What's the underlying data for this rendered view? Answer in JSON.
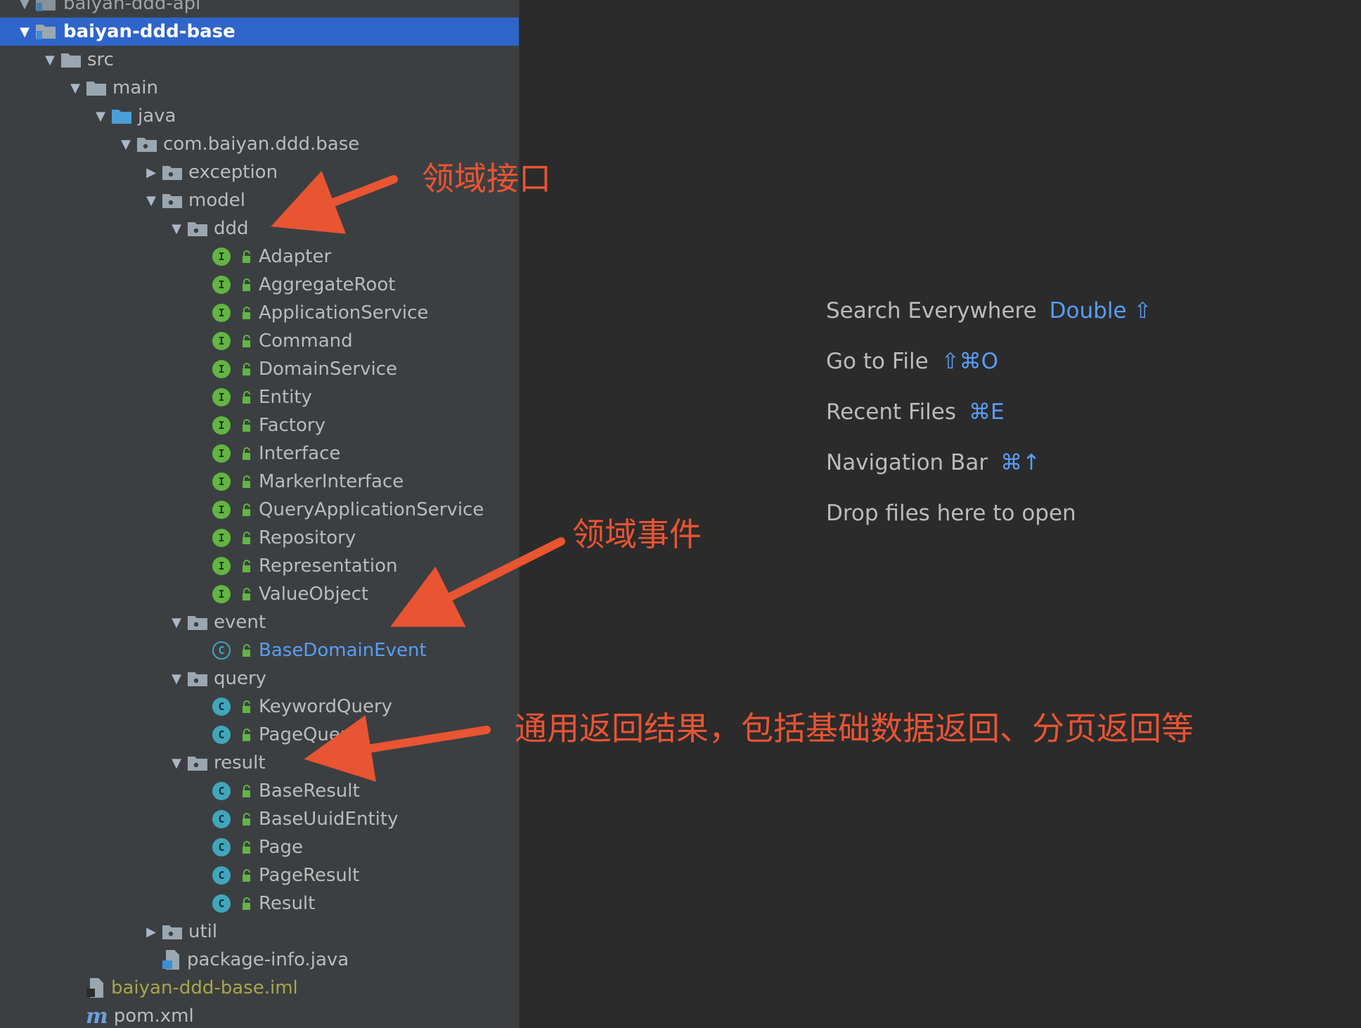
{
  "tree": {
    "rows": [
      {
        "label": "baiyan-ddd-api",
        "arrow": "expanded",
        "icon": "module-folder-icon",
        "partial": true
      },
      {
        "label": "baiyan-ddd-base",
        "arrow": "expanded",
        "icon": "module-folder-icon",
        "selected": true
      },
      {
        "label": "src",
        "arrow": "expanded",
        "icon": "folder-icon"
      },
      {
        "label": "main",
        "arrow": "expanded",
        "icon": "folder-icon"
      },
      {
        "label": "java",
        "arrow": "expanded",
        "icon": "source-folder-icon"
      },
      {
        "label": "com.baiyan.ddd.base",
        "arrow": "expanded",
        "icon": "package-icon"
      },
      {
        "label": "exception",
        "arrow": "collapsed",
        "icon": "package-icon"
      },
      {
        "label": "model",
        "arrow": "expanded",
        "icon": "package-icon"
      },
      {
        "label": "ddd",
        "arrow": "expanded",
        "icon": "package-icon"
      },
      {
        "label": "Adapter",
        "arrow": "none",
        "icon": "interface-icon"
      },
      {
        "label": "AggregateRoot",
        "arrow": "none",
        "icon": "interface-icon"
      },
      {
        "label": "ApplicationService",
        "arrow": "none",
        "icon": "interface-icon"
      },
      {
        "label": "Command",
        "arrow": "none",
        "icon": "interface-icon"
      },
      {
        "label": "DomainService",
        "arrow": "none",
        "icon": "interface-icon"
      },
      {
        "label": "Entity",
        "arrow": "none",
        "icon": "interface-icon"
      },
      {
        "label": "Factory",
        "arrow": "none",
        "icon": "interface-icon"
      },
      {
        "label": "Interface",
        "arrow": "none",
        "icon": "interface-icon"
      },
      {
        "label": "MarkerInterface",
        "arrow": "none",
        "icon": "interface-icon"
      },
      {
        "label": "QueryApplicationService",
        "arrow": "none",
        "icon": "interface-icon"
      },
      {
        "label": "Repository",
        "arrow": "none",
        "icon": "interface-icon"
      },
      {
        "label": "Representation",
        "arrow": "none",
        "icon": "interface-icon"
      },
      {
        "label": "ValueObject",
        "arrow": "none",
        "icon": "interface-icon"
      },
      {
        "label": "event",
        "arrow": "expanded",
        "icon": "package-icon"
      },
      {
        "label": "BaseDomainEvent",
        "arrow": "none",
        "icon": "abstract-class-icon",
        "color": "blue"
      },
      {
        "label": "query",
        "arrow": "expanded",
        "icon": "package-icon"
      },
      {
        "label": "KeywordQuery",
        "arrow": "none",
        "icon": "class-icon"
      },
      {
        "label": "PageQuery",
        "arrow": "none",
        "icon": "class-icon"
      },
      {
        "label": "result",
        "arrow": "expanded",
        "icon": "package-icon"
      },
      {
        "label": "BaseResult",
        "arrow": "none",
        "icon": "class-icon"
      },
      {
        "label": "BaseUuidEntity",
        "arrow": "none",
        "icon": "class-icon"
      },
      {
        "label": "Page",
        "arrow": "none",
        "icon": "class-icon"
      },
      {
        "label": "PageResult",
        "arrow": "none",
        "icon": "class-icon"
      },
      {
        "label": "Result",
        "arrow": "none",
        "icon": "class-icon"
      },
      {
        "label": "util",
        "arrow": "collapsed",
        "icon": "package-icon"
      },
      {
        "label": "package-info.java",
        "arrow": "none",
        "icon": "java-file-icon"
      },
      {
        "label": "baiyan-ddd-base.iml",
        "arrow": "none",
        "icon": "iml-file-icon",
        "color": "olive"
      },
      {
        "label": "pom.xml",
        "arrow": "none",
        "icon": "maven-icon"
      }
    ]
  },
  "welcome": {
    "hints": [
      {
        "label": "Search Everywhere",
        "shortcut": "Double ⇧"
      },
      {
        "label": "Go to File",
        "shortcut": "⇧⌘O"
      },
      {
        "label": "Recent Files",
        "shortcut": "⌘E"
      },
      {
        "label": "Navigation Bar",
        "shortcut": "⌘↑"
      },
      {
        "label": "Drop files here to open",
        "shortcut": ""
      }
    ]
  },
  "annotations": {
    "domain_interface": "领域接口",
    "domain_event": "领域事件",
    "common_result": "通用返回结果，包括基础数据返回、分页返回等"
  },
  "colors": {
    "panel_bg": "#3c3f41",
    "editor_bg": "#2b2b2b",
    "selection": "#2f65ca",
    "annotation": "#e95432",
    "shortcut": "#589df6"
  }
}
